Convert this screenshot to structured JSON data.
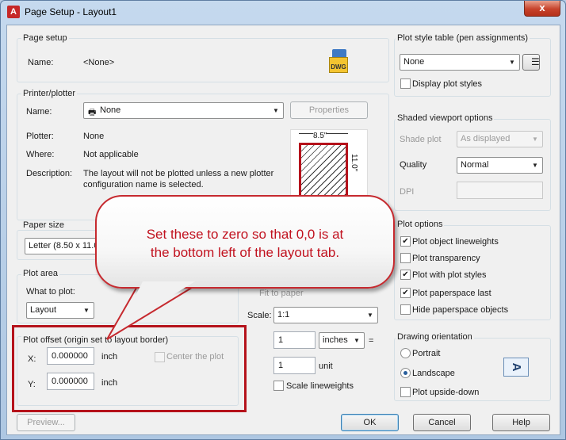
{
  "window": {
    "title": "Page Setup - Layout1",
    "app_icon": "A",
    "close_glyph": "x"
  },
  "page_setup": {
    "group_title": "Page setup",
    "name_label": "Name:",
    "name_value": "<None>",
    "dwg_icon_text": "DWG"
  },
  "printer": {
    "group_title": "Printer/plotter",
    "name_label": "Name:",
    "name_value": "None",
    "properties_label": "Properties",
    "plotter_label": "Plotter:",
    "plotter_value": "None",
    "where_label": "Where:",
    "where_value": "Not applicable",
    "description_label": "Description:",
    "description_line1": "The layout will not be plotted unless a new plotter",
    "description_line2": "configuration name is selected.",
    "preview_width": "8.5\"",
    "preview_height": "11.0\""
  },
  "paper_size": {
    "group_title": "Paper size",
    "value": "Letter (8.50 x 11.0"
  },
  "plot_area": {
    "group_title": "Plot area",
    "what_label": "What to plot:",
    "what_value": "Layout"
  },
  "plot_offset": {
    "group_title": "Plot offset (origin set to layout border)",
    "x_label": "X:",
    "x_value": "0.000000",
    "x_unit": "inch",
    "y_label": "Y:",
    "y_value": "0.000000",
    "y_unit": "inch",
    "center_label": "Center the plot"
  },
  "plot_scale": {
    "fit_label": "Fit to paper",
    "scale_label": "Scale:",
    "scale_value": "1:1",
    "num_value": "1",
    "unit_combo": "inches",
    "equals": "=",
    "den_value": "1",
    "den_unit": "unit",
    "lineweights_label": "Scale lineweights"
  },
  "plot_style": {
    "group_title": "Plot style table (pen assignments)",
    "value": "None",
    "display_label": "Display plot styles"
  },
  "shaded": {
    "group_title": "Shaded viewport options",
    "shade_label": "Shade plot",
    "shade_value": "As displayed",
    "quality_label": "Quality",
    "quality_value": "Normal",
    "dpi_label": "DPI"
  },
  "plot_options": {
    "group_title": "Plot options",
    "items": [
      {
        "label": "Plot object lineweights",
        "mark": "✔"
      },
      {
        "label": "Plot transparency",
        "mark": ""
      },
      {
        "label": "Plot with plot styles",
        "mark": "✔"
      },
      {
        "label": "Plot paperspace last",
        "mark": "✔"
      },
      {
        "label": "Hide paperspace objects",
        "mark": ""
      }
    ]
  },
  "orientation": {
    "group_title": "Drawing orientation",
    "portrait_label": "Portrait",
    "landscape_label": "Landscape",
    "upside_label": "Plot upside-down",
    "icon_letter": "A"
  },
  "buttons": {
    "preview": "Preview...",
    "ok": "OK",
    "cancel": "Cancel",
    "help": "Help"
  },
  "callout": {
    "line1": "Set these to zero so that 0,0 is at",
    "line2": "the bottom left of the layout tab."
  },
  "colors": {
    "annotation_red": "#b5121b",
    "callout_text": "#c1121f"
  }
}
